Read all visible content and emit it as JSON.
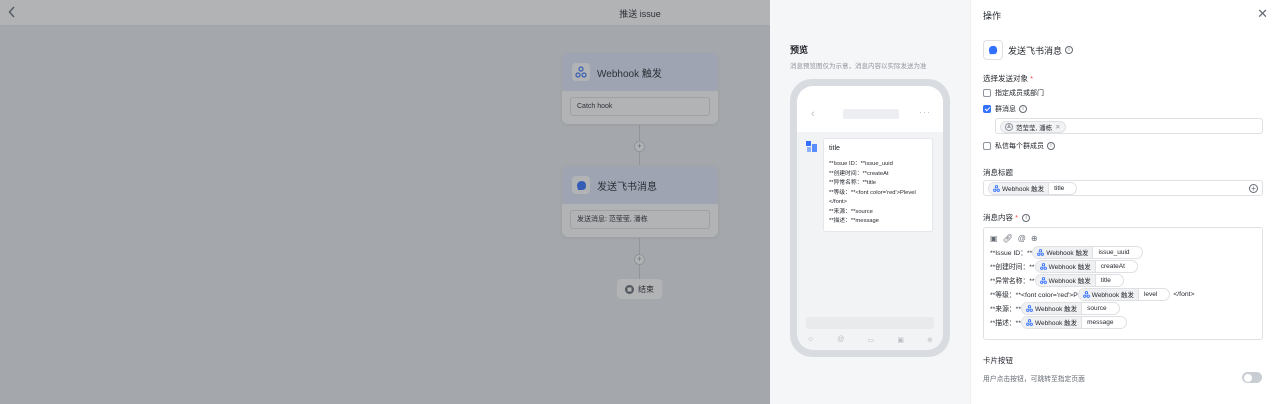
{
  "header": {
    "title": "推送 issue"
  },
  "flow": {
    "nodes": [
      {
        "title": "Webhook 触发",
        "field": "Catch hook"
      },
      {
        "title": "发送飞书消息",
        "field": "发送消息: 范莹莹, 潘栋"
      }
    ],
    "end_label": "结束"
  },
  "preview": {
    "title": "预览",
    "desc": "消息预览图仅为示意，消息内容以实际发送为准",
    "message_title": "title",
    "message_lines": [
      "**Issue ID：**issue_uuid",
      "**创建时间：**createAt",
      "**异常名称：**title",
      "**等级：**<font color='red'>Plevel",
      "</font>",
      "**来源：**source",
      "**描述：**message"
    ]
  },
  "panel": {
    "title": "操作",
    "action_name": "发送飞书消息",
    "target_label": "选择发送对象",
    "option_members": "指定成员或部门",
    "option_group": "群消息",
    "group_chip": "范莹莹, 潘栋",
    "option_private": "私信每个群成员",
    "subject_label": "消息标题",
    "subject_source": "Webhook 触发",
    "subject_field": "title",
    "content_label": "消息内容",
    "content_lines": [
      {
        "prefix": "**Issue ID：**",
        "source": "Webhook 触发",
        "field": "issue_uuid",
        "suffix": ""
      },
      {
        "prefix": "**创建时间：**",
        "source": "Webhook 触发",
        "field": "createAt",
        "suffix": ""
      },
      {
        "prefix": "**异常名称：**",
        "source": "Webhook 触发",
        "field": "title",
        "suffix": ""
      },
      {
        "prefix": "**等级：**<font color='red'>P",
        "source": "Webhook 触发",
        "field": "level",
        "suffix": "</font>"
      },
      {
        "prefix": "**来源：**",
        "source": "Webhook 触发",
        "field": "source",
        "suffix": ""
      },
      {
        "prefix": "**描述：**",
        "source": "Webhook 触发",
        "field": "message",
        "suffix": ""
      }
    ],
    "card_button_label": "卡片按钮",
    "card_button_desc": "用户点击按钮，可跳转至指定页面"
  }
}
